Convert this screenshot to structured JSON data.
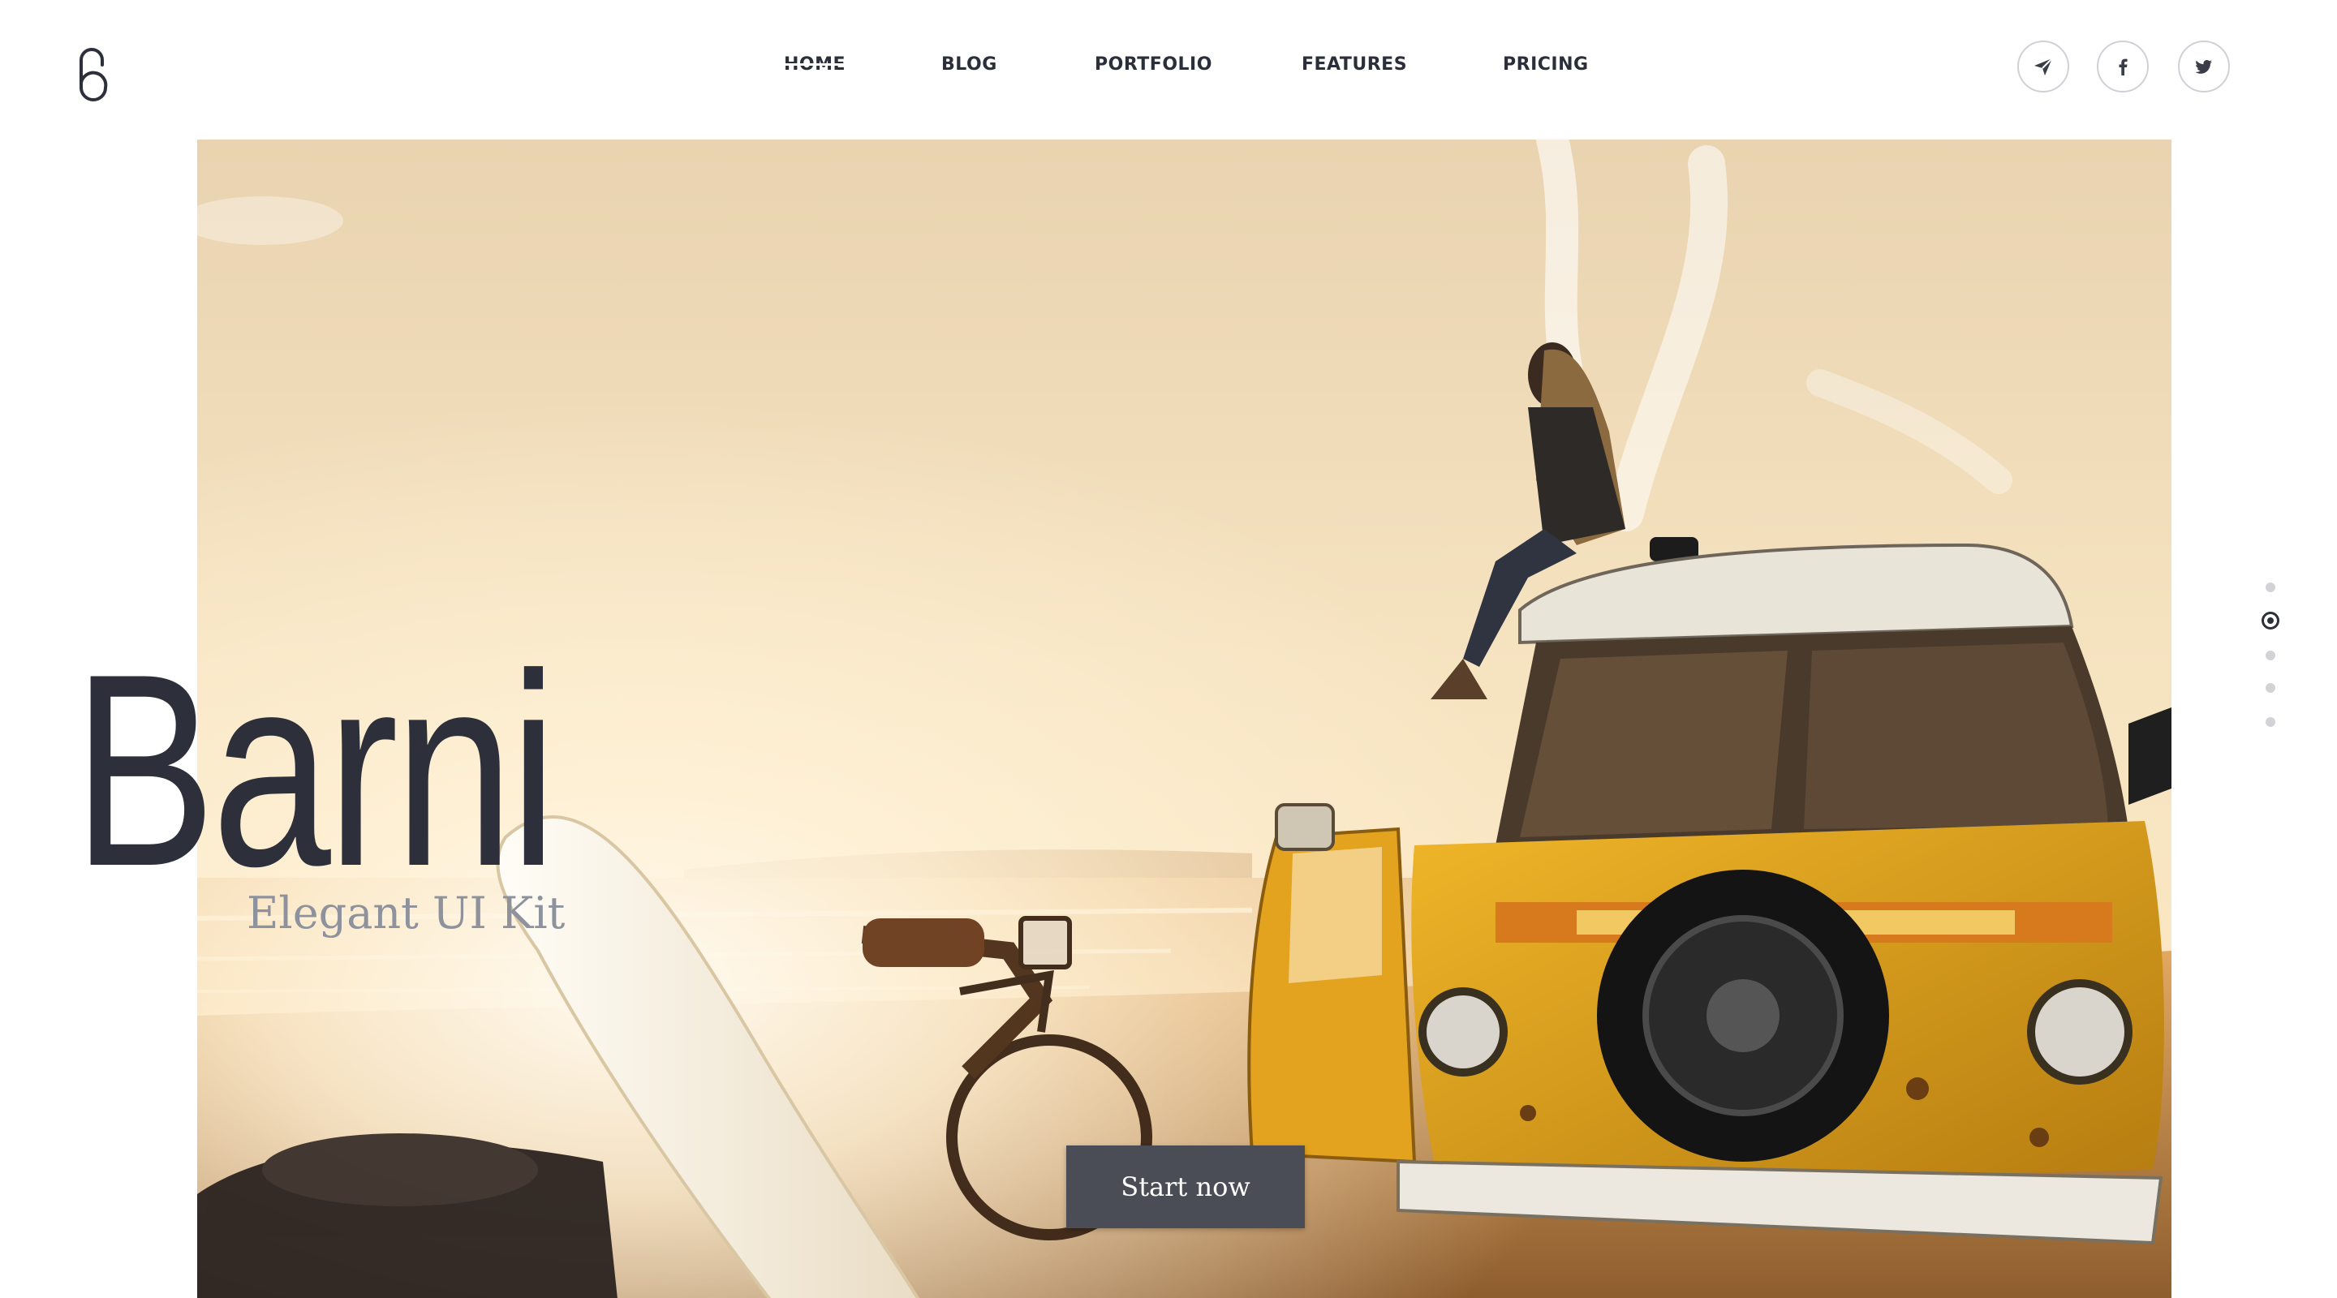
{
  "brand": {
    "logo_icon": "barni-b-logo-icon"
  },
  "nav": {
    "items": [
      {
        "label": "HOME",
        "active": true
      },
      {
        "label": "BLOG",
        "active": false
      },
      {
        "label": "PORTFOLIO",
        "active": false
      },
      {
        "label": "FEATURES",
        "active": false
      },
      {
        "label": "PRICING",
        "active": false
      }
    ]
  },
  "social": {
    "icons": [
      "telegram-icon",
      "facebook-icon",
      "twitter-icon"
    ]
  },
  "hero": {
    "title": "Barni",
    "subtitle": "Elegant UI Kit",
    "cta_label": "Start now",
    "image": "beach-van-surfboard-photo"
  },
  "pager": {
    "count": 5,
    "active_index": 1
  },
  "colors": {
    "text_dark": "#2d2f3b",
    "subtitle_gray": "#8e929c",
    "button_bg": "#4a4d55",
    "van_yellow": "#e0a51c"
  }
}
